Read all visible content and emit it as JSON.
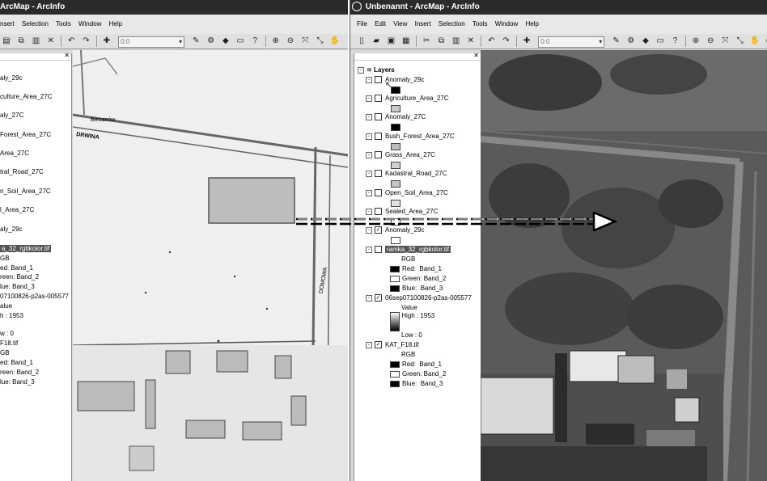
{
  "left_window": {
    "title": "ArcMap - ArcInfo",
    "menu": [
      "nsert",
      "Selection",
      "Tools",
      "Window",
      "Help"
    ],
    "scale_value": "0:0",
    "toc_items": [
      "aly_29c",
      "culture_Area_27C",
      "aly_27C",
      "Forest_Area_27C",
      "Area_27C",
      "tral_Road_27C",
      "n_Soil_Area_27C",
      "l_Area_27C",
      "aly_29c"
    ],
    "selected_layer": "a_32_rgbkolor.tif",
    "lines": [
      "GB",
      "ed: Band_1",
      "reen: Band_2",
      "lue: Band_3",
      "07100826-p2as-005577",
      "alue",
      "h : 1953",
      "w : 0",
      "F18.tif",
      "GB",
      "ed: Band_1",
      "reen: Band_2",
      "lue: Band_3"
    ],
    "map_labels": [
      "Biezanów",
      "DRWINA",
      "DOMOWA"
    ]
  },
  "right_window": {
    "title": "Unbenannt - ArcMap - ArcInfo",
    "menu": [
      "File",
      "Edit",
      "View",
      "Insert",
      "Selection",
      "Tools",
      "Window",
      "Help"
    ],
    "scale_value": "0:0",
    "toc_root": "Layers",
    "layers": [
      {
        "name": "Anomaly_29c",
        "checked": false,
        "swatch": "#000000"
      },
      {
        "name": "Agriculture_Area_27C",
        "checked": false,
        "swatch": "#c8c8c8"
      },
      {
        "name": "Anomaly_27C",
        "checked": false,
        "swatch": "#000000"
      },
      {
        "name": "Bush_Forest_Area_27C",
        "checked": false,
        "swatch": "#bdbdbd"
      },
      {
        "name": "Grass_Area_27C",
        "checked": false,
        "swatch": "#d0d0d0"
      },
      {
        "name": "Kadastral_Road_27C",
        "checked": false,
        "swatch": "#c4c4c4"
      },
      {
        "name": "Open_Soil_Area_27C",
        "checked": false,
        "swatch": "#e2e2e2"
      },
      {
        "name": "Sealed_Area_27C",
        "checked": false,
        "swatch": "#ffffff"
      },
      {
        "name": "Anomaly_29c",
        "checked": true,
        "swatch": "#ffffff"
      }
    ],
    "raster1": {
      "name": "ramka_32_rgbkolor.tif",
      "rgb": "RGB",
      "red": "Red:",
      "red_band": "Band_1",
      "green": "Green:",
      "green_band": "Band_2",
      "blue": "Blue:",
      "blue_band": "Band_3"
    },
    "raster2": {
      "name": "06sep07100826-p2as-005577",
      "value": "Value",
      "high": "High : 1953",
      "low": "Low : 0"
    },
    "raster3": {
      "name": "KAT_F18.tif",
      "rgb": "RGB",
      "red": "Red:",
      "red_band": "Band_1",
      "green": "Green: Band_2",
      "blue": "Blue:",
      "blue_band": "Band_3"
    }
  }
}
